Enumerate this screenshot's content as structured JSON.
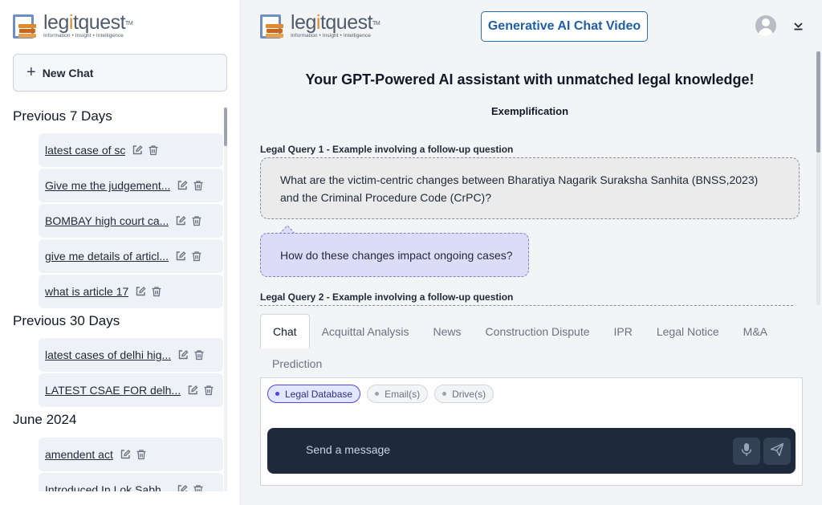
{
  "logo": {
    "name_pre": "leg",
    "name_i": "i",
    "name_post": "tquest",
    "tm": "TM",
    "tagline": "Information • Insight • Intelligence"
  },
  "sidebar": {
    "new_chat_label": "New Chat",
    "groups": [
      {
        "title": "Previous 7 Days",
        "items": [
          "latest case of sc",
          "Give me the judgement...",
          "BOMBAY high court ca...",
          "give me details of articl...",
          "what is article 17"
        ]
      },
      {
        "title": "Previous 30 Days",
        "items": [
          "latest cases of delhi hig...",
          "LATEST CSAE FOR delh..."
        ]
      },
      {
        "title": "June 2024",
        "items": [
          "amendent act",
          "Introduced In Lok Sabh..."
        ]
      }
    ]
  },
  "header": {
    "gen_video_label": "Generative AI Chat Video"
  },
  "main": {
    "headline": "Your GPT-Powered AI assistant with unmatched legal knowledge!",
    "subhead": "Exemplification",
    "query1_label": "Legal Query 1 - Example involving a follow-up question",
    "query1_text": "What are the victim-centric changes between Bharatiya Nagarik Suraksha Sanhita (BNSS,2023) and the Criminal Procedure Code (CrPC)?",
    "followup_text": "How do these changes impact ongoing cases?",
    "query2_label": "Legal Query 2 - Example involving a follow-up question"
  },
  "tabs": [
    "Chat",
    "Acquittal Analysis",
    "News",
    "Construction Dispute",
    "IPR",
    "Legal Notice",
    "M&A",
    "Prediction"
  ],
  "sources": [
    "Legal Database",
    "Email(s)",
    "Drive(s)"
  ],
  "composer": {
    "placeholder": "Send a message"
  },
  "colors": {
    "brand_blue": "#1e5fa8",
    "composer_bg": "#1e293b",
    "followup_bg": "#dcdcf8",
    "active_chip": "#4f46e5"
  },
  "icons": [
    "logo-books-icon",
    "plus-icon",
    "edit-icon",
    "trash-icon",
    "user-avatar-icon",
    "chevron-down-icon",
    "microphone-icon",
    "send-icon"
  ]
}
